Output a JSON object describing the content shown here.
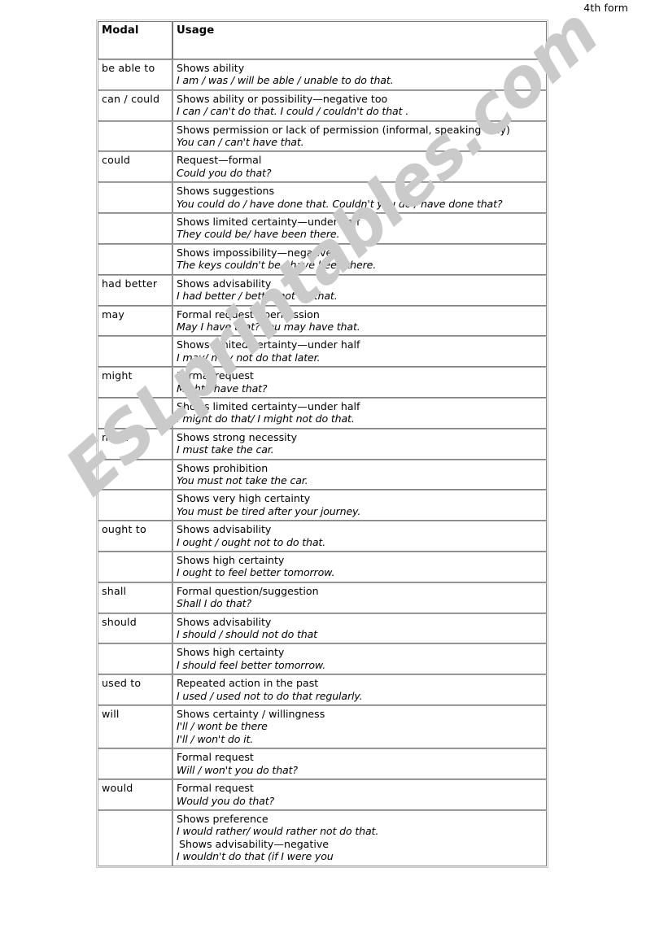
{
  "header": {
    "form_label": "4th form"
  },
  "watermark": {
    "text": "ESLprintables.com",
    "color": "#cacaca"
  },
  "table": {
    "columns": [
      "Modal",
      "Usage"
    ],
    "rows": [
      {
        "modal": "be able to",
        "lines": [
          {
            "text": "Shows ability",
            "italic": false
          },
          {
            "text": "I am / was / will be able / unable to do that.",
            "italic": true
          }
        ]
      },
      {
        "modal": "can / could",
        "lines": [
          {
            "text": "Shows ability or possibility—negative too",
            "italic": false
          },
          {
            "text": "I can / can't do that. I could / couldn't do that .",
            "italic": true
          }
        ]
      },
      {
        "modal": "",
        "lines": [
          {
            "text": "Shows permission or lack of permission (informal, speaking only)",
            "italic": false
          },
          {
            "text": "You can / can't have that.",
            "italic": true
          }
        ]
      },
      {
        "modal": "could",
        "lines": [
          {
            "text": "Request—formal",
            "italic": false
          },
          {
            "text": "Could you do that?",
            "italic": true
          }
        ]
      },
      {
        "modal": "",
        "lines": [
          {
            "text": "Shows suggestions",
            "italic": false
          },
          {
            "text": "You could do / have done that. Couldn't you do / have done that?",
            "italic": true
          }
        ]
      },
      {
        "modal": "",
        "lines": [
          {
            "text": "Shows limited certainty—under half",
            "italic": false
          },
          {
            "text": "They could be/ have been there.",
            "italic": true
          }
        ]
      },
      {
        "modal": "",
        "lines": [
          {
            "text": "Shows impossibility—negative",
            "italic": false
          },
          {
            "text": "The keys couldn't be / have been there.",
            "italic": true
          }
        ]
      },
      {
        "modal": "had better",
        "lines": [
          {
            "text": "Shows advisability",
            "italic": false
          },
          {
            "text": "I had better / better not do that.",
            "italic": true
          }
        ]
      },
      {
        "modal": "may",
        "lines": [
          {
            "text": "Formal request / permission",
            "italic": false
          },
          {
            "text": "May I have that? You may have that.",
            "italic": true
          }
        ]
      },
      {
        "modal": "",
        "lines": [
          {
            "text": "Shows limited certainty—under half",
            "italic": false
          },
          {
            "text": "I may/ may not do that later.",
            "italic": true
          }
        ]
      },
      {
        "modal": "might",
        "lines": [
          {
            "text": "Formal request",
            "italic": false
          },
          {
            "text": "Might I have that?",
            "italic": true
          }
        ]
      },
      {
        "modal": "",
        "lines": [
          {
            "text": "Shows limited certainty—under half",
            "italic": false
          },
          {
            "text": "I might do that/ I might not do that.",
            "italic": true
          }
        ]
      },
      {
        "modal": "must",
        "lines": [
          {
            "text": "Shows strong necessity",
            "italic": false
          },
          {
            "text": "I must take the car.",
            "italic": true
          }
        ]
      },
      {
        "modal": "",
        "lines": [
          {
            "text": "Shows prohibition",
            "italic": false
          },
          {
            "text": "You must not take the car.",
            "italic": true
          }
        ]
      },
      {
        "modal": "",
        "lines": [
          {
            "text": "Shows very high certainty",
            "italic": false
          },
          {
            "text": "You must be tired after your journey.",
            "italic": true
          }
        ]
      },
      {
        "modal": "ought to",
        "lines": [
          {
            "text": "Shows advisability",
            "italic": false
          },
          {
            "text": "I ought / ought not to do that.",
            "italic": true
          }
        ]
      },
      {
        "modal": "",
        "lines": [
          {
            "text": "Shows high certainty",
            "italic": false
          },
          {
            "text": "I ought to feel better tomorrow.",
            "italic": true
          }
        ]
      },
      {
        "modal": "shall",
        "lines": [
          {
            "text": "Formal question/suggestion",
            "italic": false
          },
          {
            "text": "Shall I do that?",
            "italic": true
          }
        ]
      },
      {
        "modal": "should",
        "lines": [
          {
            "text": "Shows advisability",
            "italic": false
          },
          {
            "text": "I should / should not do that",
            "italic": true
          }
        ]
      },
      {
        "modal": "",
        "lines": [
          {
            "text": "Shows high certainty",
            "italic": false
          },
          {
            "text": "I should feel better tomorrow.",
            "italic": true
          }
        ]
      },
      {
        "modal": "used to",
        "lines": [
          {
            "text": "Repeated action in the past",
            "italic": false
          },
          {
            "text": "I used / used not to do that regularly.",
            "italic": true
          }
        ]
      },
      {
        "modal": "will",
        "lines": [
          {
            "text": "Shows certainty / willingness",
            "italic": false
          },
          {
            "text": "I'll / wont be there",
            "italic": true
          },
          {
            "text": "I'll / won't do it.",
            "italic": true
          }
        ]
      },
      {
        "modal": "",
        "lines": [
          {
            "text": "Formal request",
            "italic": false
          },
          {
            "text": "Will / won't you do that?",
            "italic": true
          }
        ]
      },
      {
        "modal": "would",
        "lines": [
          {
            "text": "Formal request",
            "italic": false
          },
          {
            "text": "Would you do that?",
            "italic": true
          }
        ]
      },
      {
        "modal": "",
        "lines": [
          {
            "text": "Shows preference",
            "italic": false
          },
          {
            "text": "I would rather/ would rather not do that.",
            "italic": true
          },
          {
            "text": " Shows advisability—negative",
            "italic": false,
            "lead_space": true
          },
          {
            "text": "I wouldn't do that (if I were you",
            "italic": true
          }
        ]
      }
    ]
  }
}
